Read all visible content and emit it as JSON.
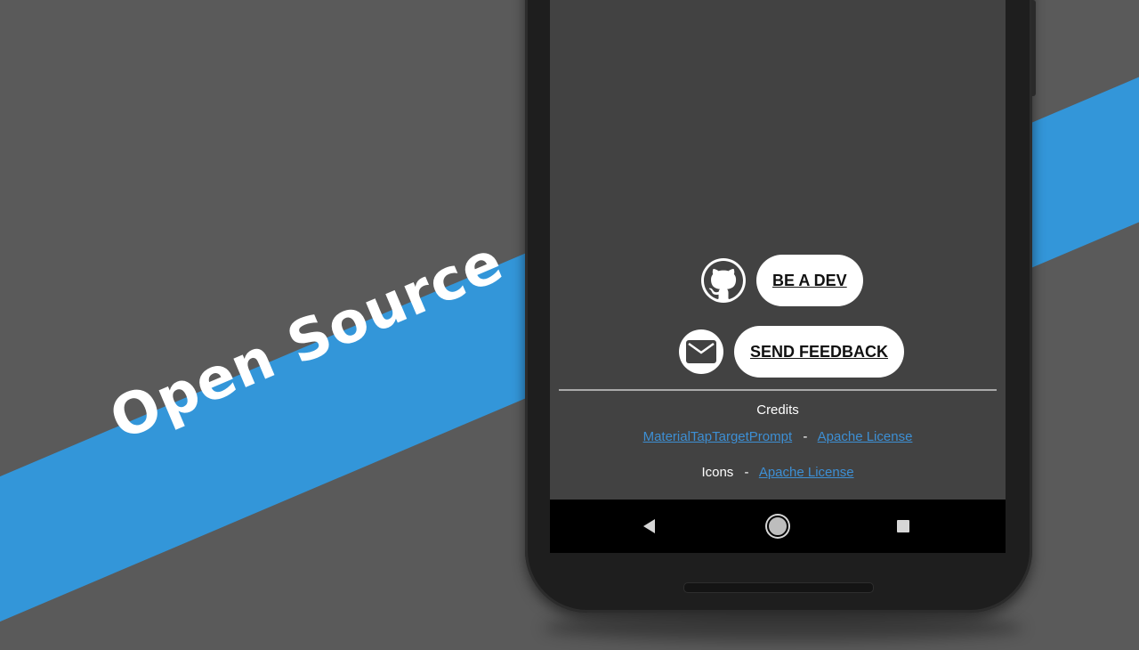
{
  "promo": {
    "text": "Open Source"
  },
  "colors": {
    "background": "#5a5a5a",
    "stripe": "#3396d9",
    "screen": "#424242",
    "link": "#3d8fd4"
  },
  "actions": {
    "dev_label": "BE A DEV",
    "dev_icon": "github-icon",
    "feedback_label": "SEND FEEDBACK",
    "feedback_icon": "mail-icon"
  },
  "credits": {
    "title": "Credits",
    "lines": [
      {
        "name": "MaterialTapTargetPrompt",
        "separator": "-",
        "license": "Apache License"
      },
      {
        "name": "Icons",
        "separator": "-",
        "license": "Apache License"
      }
    ]
  },
  "navbar": {
    "back_icon": "back-triangle-icon",
    "home_icon": "home-circle-icon",
    "recents_icon": "recents-square-icon"
  }
}
